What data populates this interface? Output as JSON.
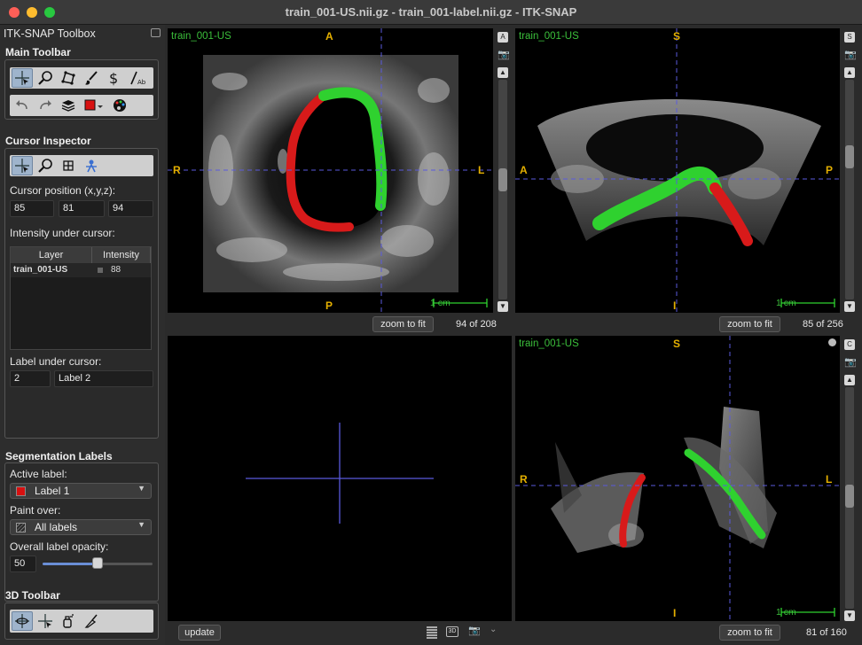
{
  "window": {
    "title": "train_001-US.nii.gz - train_001-label.nii.gz - ITK-SNAP"
  },
  "toolbox": {
    "title": "ITK-SNAP Toolbox",
    "main_toolbar": {
      "title": "Main Toolbar",
      "row1": [
        "crosshair-mode-icon",
        "zoom-mode-icon",
        "polygon-mode-icon",
        "paintbrush-mode-icon",
        "snake-mode-icon",
        "annotation-mode-icon"
      ],
      "row2": [
        "undo-icon",
        "redo-icon",
        "layers-icon",
        "label-color-icon",
        "palette-icon"
      ]
    },
    "cursor_inspector": {
      "title": "Cursor Inspector",
      "position_label": "Cursor position (x,y,z):",
      "x": "85",
      "y": "81",
      "z": "94",
      "intensity_label": "Intensity under cursor:",
      "table": {
        "headers": [
          "Layer",
          "Intensity"
        ],
        "rows": [
          {
            "layer": "train_001-US",
            "intensity": "88"
          }
        ]
      },
      "label_under_cursor_label": "Label under cursor:",
      "label_id": "2",
      "label_name": "Label 2"
    },
    "segmentation_labels": {
      "title": "Segmentation Labels",
      "active_label_caption": "Active label:",
      "active_label": "Label 1",
      "active_label_color": "#d81010",
      "paint_over_caption": "Paint over:",
      "paint_over": "All labels",
      "opacity_caption": "Overall label opacity:",
      "opacity_value": "50",
      "opacity_fraction": 0.5
    },
    "toolbar_3d": {
      "title": "3D Toolbar",
      "tools": [
        "3d-rotate-icon",
        "3d-crosshair-icon",
        "3d-spray-icon",
        "3d-scalpel-icon"
      ]
    }
  },
  "views": {
    "axial": {
      "layer": "train_001-US",
      "top": "A",
      "bottom": "P",
      "left": "R",
      "right": "L",
      "scale": "1 cm",
      "zoom_button": "zoom to fit",
      "slice": "94 of 208",
      "view_button": "A"
    },
    "sagittal": {
      "layer": "train_001-US",
      "top": "S",
      "bottom": "I",
      "left": "A",
      "right": "P",
      "scale": "1 cm",
      "zoom_button": "zoom to fit",
      "slice": "85 of 256",
      "view_button": "S"
    },
    "render3d": {
      "update_button": "update"
    },
    "coronal": {
      "layer": "train_001-US",
      "top": "S",
      "bottom": "I",
      "left": "R",
      "right": "L",
      "scale": "1 cm",
      "zoom_button": "zoom to fit",
      "slice": "81 of 160",
      "view_button": "C"
    }
  },
  "colors": {
    "label_green": "#2fd12f",
    "label_red": "#d81a1a",
    "orient_yellow": "#e5b000",
    "crosshair": "#5a5adc"
  }
}
